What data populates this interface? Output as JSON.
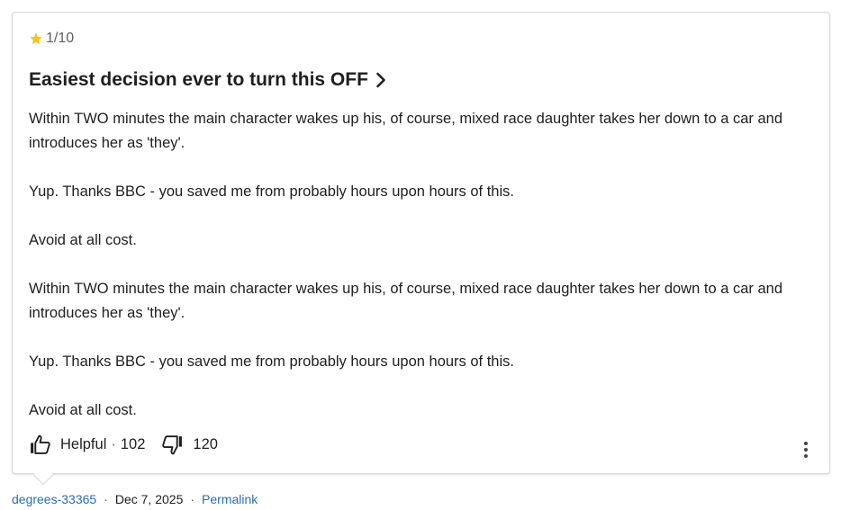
{
  "review": {
    "rating": "1/10",
    "title": "Easiest decision ever to turn this OFF",
    "paragraphs": [
      "Within TWO minutes the main character wakes up his, of course, mixed race daughter takes her down to a car and introduces her as 'they'.",
      "Yup. Thanks BBC - you saved me from probably hours upon hours of this.",
      "Avoid at all cost.",
      "Within TWO minutes the main character wakes up his, of course, mixed race daughter takes her down to a car and introduces her as 'they'.",
      "Yup. Thanks BBC - you saved me from probably hours upon hours of this.",
      "Avoid at all cost."
    ],
    "helpful_label": "Helpful",
    "helpful_sep": "·",
    "upvotes": "102",
    "downvotes": "120"
  },
  "footer": {
    "author": "degrees-33365",
    "sep1": "·",
    "date": "Dec 7, 2025",
    "sep2": "·",
    "permalink": "Permalink"
  },
  "icons": {
    "star": "star-icon",
    "chevron": "chevron-right-icon",
    "thumb_up": "thumb-up-icon",
    "thumb_down": "thumb-down-icon",
    "more": "more-vertical-icon"
  },
  "colors": {
    "star": "#f5c518",
    "link": "#2a6fb0",
    "text": "#1f1f1f",
    "muted": "#5f5f5f"
  }
}
